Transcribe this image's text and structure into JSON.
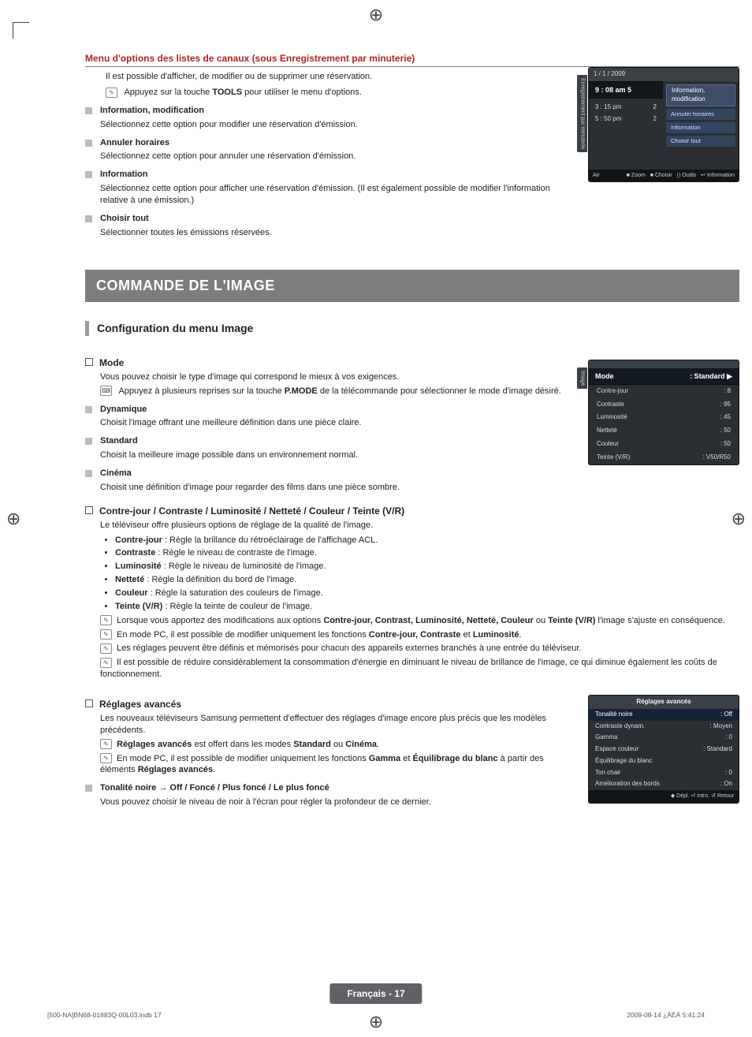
{
  "header": {
    "title": "Menu d'options des listes de canaux (sous Enregistrement par minuterie)"
  },
  "intro": {
    "line1": "Il est possible d'afficher, de modifier ou de supprimer une réservation.",
    "tools_pre": "Appuyez sur la touche ",
    "tools_key": "TOOLS",
    "tools_post": " pour utiliser le menu d'options."
  },
  "opts": {
    "info_mod": {
      "t": "Information, modification",
      "b": "Sélectionnez cette option pour modifier une réservation d'émission."
    },
    "annuler": {
      "t": "Annuler horaires",
      "b": "Sélectionnez cette option pour annuler une réservation d'émission."
    },
    "info": {
      "t": "Information",
      "b": "Sélectionnez cette option pour afficher une réservation d'émission. (Il est également possible de modifier l'information relative à une émission.)"
    },
    "choisir": {
      "t": "Choisir tout",
      "b": "Sélectionner toutes les émissions réservées."
    }
  },
  "osd1": {
    "side": "Enregistrement par minuterie",
    "date": "1 / 1 / 2009",
    "time": "9 : 08 am  5",
    "rows": [
      {
        "a": "3 : 15 pm",
        "b": "2"
      },
      {
        "a": "5 : 50 pm",
        "b": "2"
      }
    ],
    "menu": [
      "Information, modification",
      "Annuler horaires",
      "Information",
      "Choisir tout"
    ],
    "air": "Air",
    "foot": [
      "■ Zoom",
      "■ Choisir",
      "⟮⟯ Outils",
      "↩ Information"
    ]
  },
  "band": "COMMANDE DE L'IMAGE",
  "subhead": "Configuration du menu Image",
  "mode": {
    "t": "Mode",
    "intro": "Vous pouvez choisir le type d'image qui correspond le mieux à vos exigences.",
    "pmode_pre": "Appuyez à plusieurs reprises sur la touche ",
    "pmode_key": "P.MODE",
    "pmode_post": " de la télécommande pour sélectionner le mode d'image désiré.",
    "items": {
      "dyn": {
        "t": "Dynamique",
        "b": "Choisit l'image offrant une meilleure définition dans une pièce claire."
      },
      "std": {
        "t": "Standard",
        "b": "Choisit la meilleure image possible dans un environnement normal."
      },
      "cin": {
        "t": "Cinéma",
        "b": "Choisit une définition d'image pour regarder des films dans une pièce sombre."
      }
    }
  },
  "osd2": {
    "side": "Image",
    "mode_l": "Mode",
    "mode_v": ": Standard   ▶",
    "pairs": [
      [
        "Contre-jour",
        ": 8"
      ],
      [
        "Contraste",
        ": 95"
      ],
      [
        "Luminosité",
        ": 45"
      ],
      [
        "Netteté",
        ": 50"
      ],
      [
        "Couleur",
        ": 50"
      ],
      [
        "Teinte (V/R)",
        ": V50/R50"
      ]
    ]
  },
  "cj": {
    "t": "Contre-jour / Contraste / Luminosité / Netteté / Couleur / Teinte (V/R)",
    "intro": "Le téléviseur offre plusieurs options de réglage de la qualité de l'image.",
    "bullets": [
      {
        "k": "Contre-jour",
        "d": " : Règle la brillance du rétroéclairage de l'affichage ACL."
      },
      {
        "k": "Contraste",
        "d": " : Règle le niveau de contraste de l'image."
      },
      {
        "k": "Luminosité",
        "d": " : Règle le niveau de luminosité de l'image."
      },
      {
        "k": "Netteté",
        "d": " : Règle la définition du bord de l'image."
      },
      {
        "k": "Couleur",
        "d": " : Règle la saturation des couleurs de l'image."
      },
      {
        "k": "Teinte (V/R)",
        "d": " : Règle la teinte de couleur de l'image."
      }
    ],
    "n1_pre": "Lorsque vous apportez des modifications aux options ",
    "n1_keys": "Contre-jour, Contrast, Luminosité, Netteté, Couleur",
    "n1_mid": " ou ",
    "n1_key2": "Teinte (V/R)",
    "n1_post": " l'image s'ajuste en conséquence.",
    "n2_pre": "En mode PC, il est possible de modifier uniquement les fonctions ",
    "n2_keys": "Contre-jour, Contraste",
    "n2_mid": " et ",
    "n2_key2": "Luminosité",
    "n2_post": ".",
    "n3": "Les réglages peuvent être définis et mémorisés pour chacun des appareils externes branchés à une entrée du téléviseur.",
    "n4": "Il est possible de réduire considérablement la consommation d'énergie en diminuant le niveau de brillance de l'image, ce qui diminue également les coûts de fonctionnement."
  },
  "adv": {
    "t": "Réglages avancés",
    "intro": "Les nouveaux téléviseurs Samsung permettent d'effectuer des réglages d'image encore plus précis que les modèles précédents.",
    "n1_k": "Réglages avancés",
    "n1_rest": " est offert dans les modes ",
    "n1_k2": "Standard",
    "n1_mid": " ou ",
    "n1_k3": "Cinéma",
    "n1_end": ".",
    "n2_pre": "En mode PC, il est possible de modifier uniquement les fonctions ",
    "n2_k1": "Gamma",
    "n2_mid": " et ",
    "n2_k2": "Équilibrage du blanc",
    "n2_post": " à partir des éléments ",
    "n2_k3": "Réglages avancés",
    "n2_end": "."
  },
  "tonalite": {
    "t": "Tonalité noire → Off / Foncé / Plus foncé / Le plus foncé",
    "b": "Vous pouvez choisir le niveau de noir à l'écran pour régler la profondeur de ce dernier."
  },
  "osd3": {
    "hd": "Réglages avancés",
    "rows": [
      [
        "Tonalité noire",
        ": Off",
        true
      ],
      [
        "Contraste dynam.",
        ": Moyen",
        false
      ],
      [
        "Gamma",
        ": 0",
        false
      ],
      [
        "Espace couleur",
        ": Standard",
        false
      ],
      [
        "Équilibrage du blanc",
        "",
        false
      ],
      [
        "Ton chair",
        ": 0",
        false
      ],
      [
        "Amélioration des bords",
        ": On",
        false
      ]
    ],
    "ft": "◆ Dépl.    ⏎ Intro.    ↺ Retour"
  },
  "footer": {
    "pill": "Français - 17",
    "left": "[500-NA]BN68-01883Q-00L03.indb   17",
    "right": "2009-08-14   ¿ÀÈÄ 5:41:24"
  }
}
